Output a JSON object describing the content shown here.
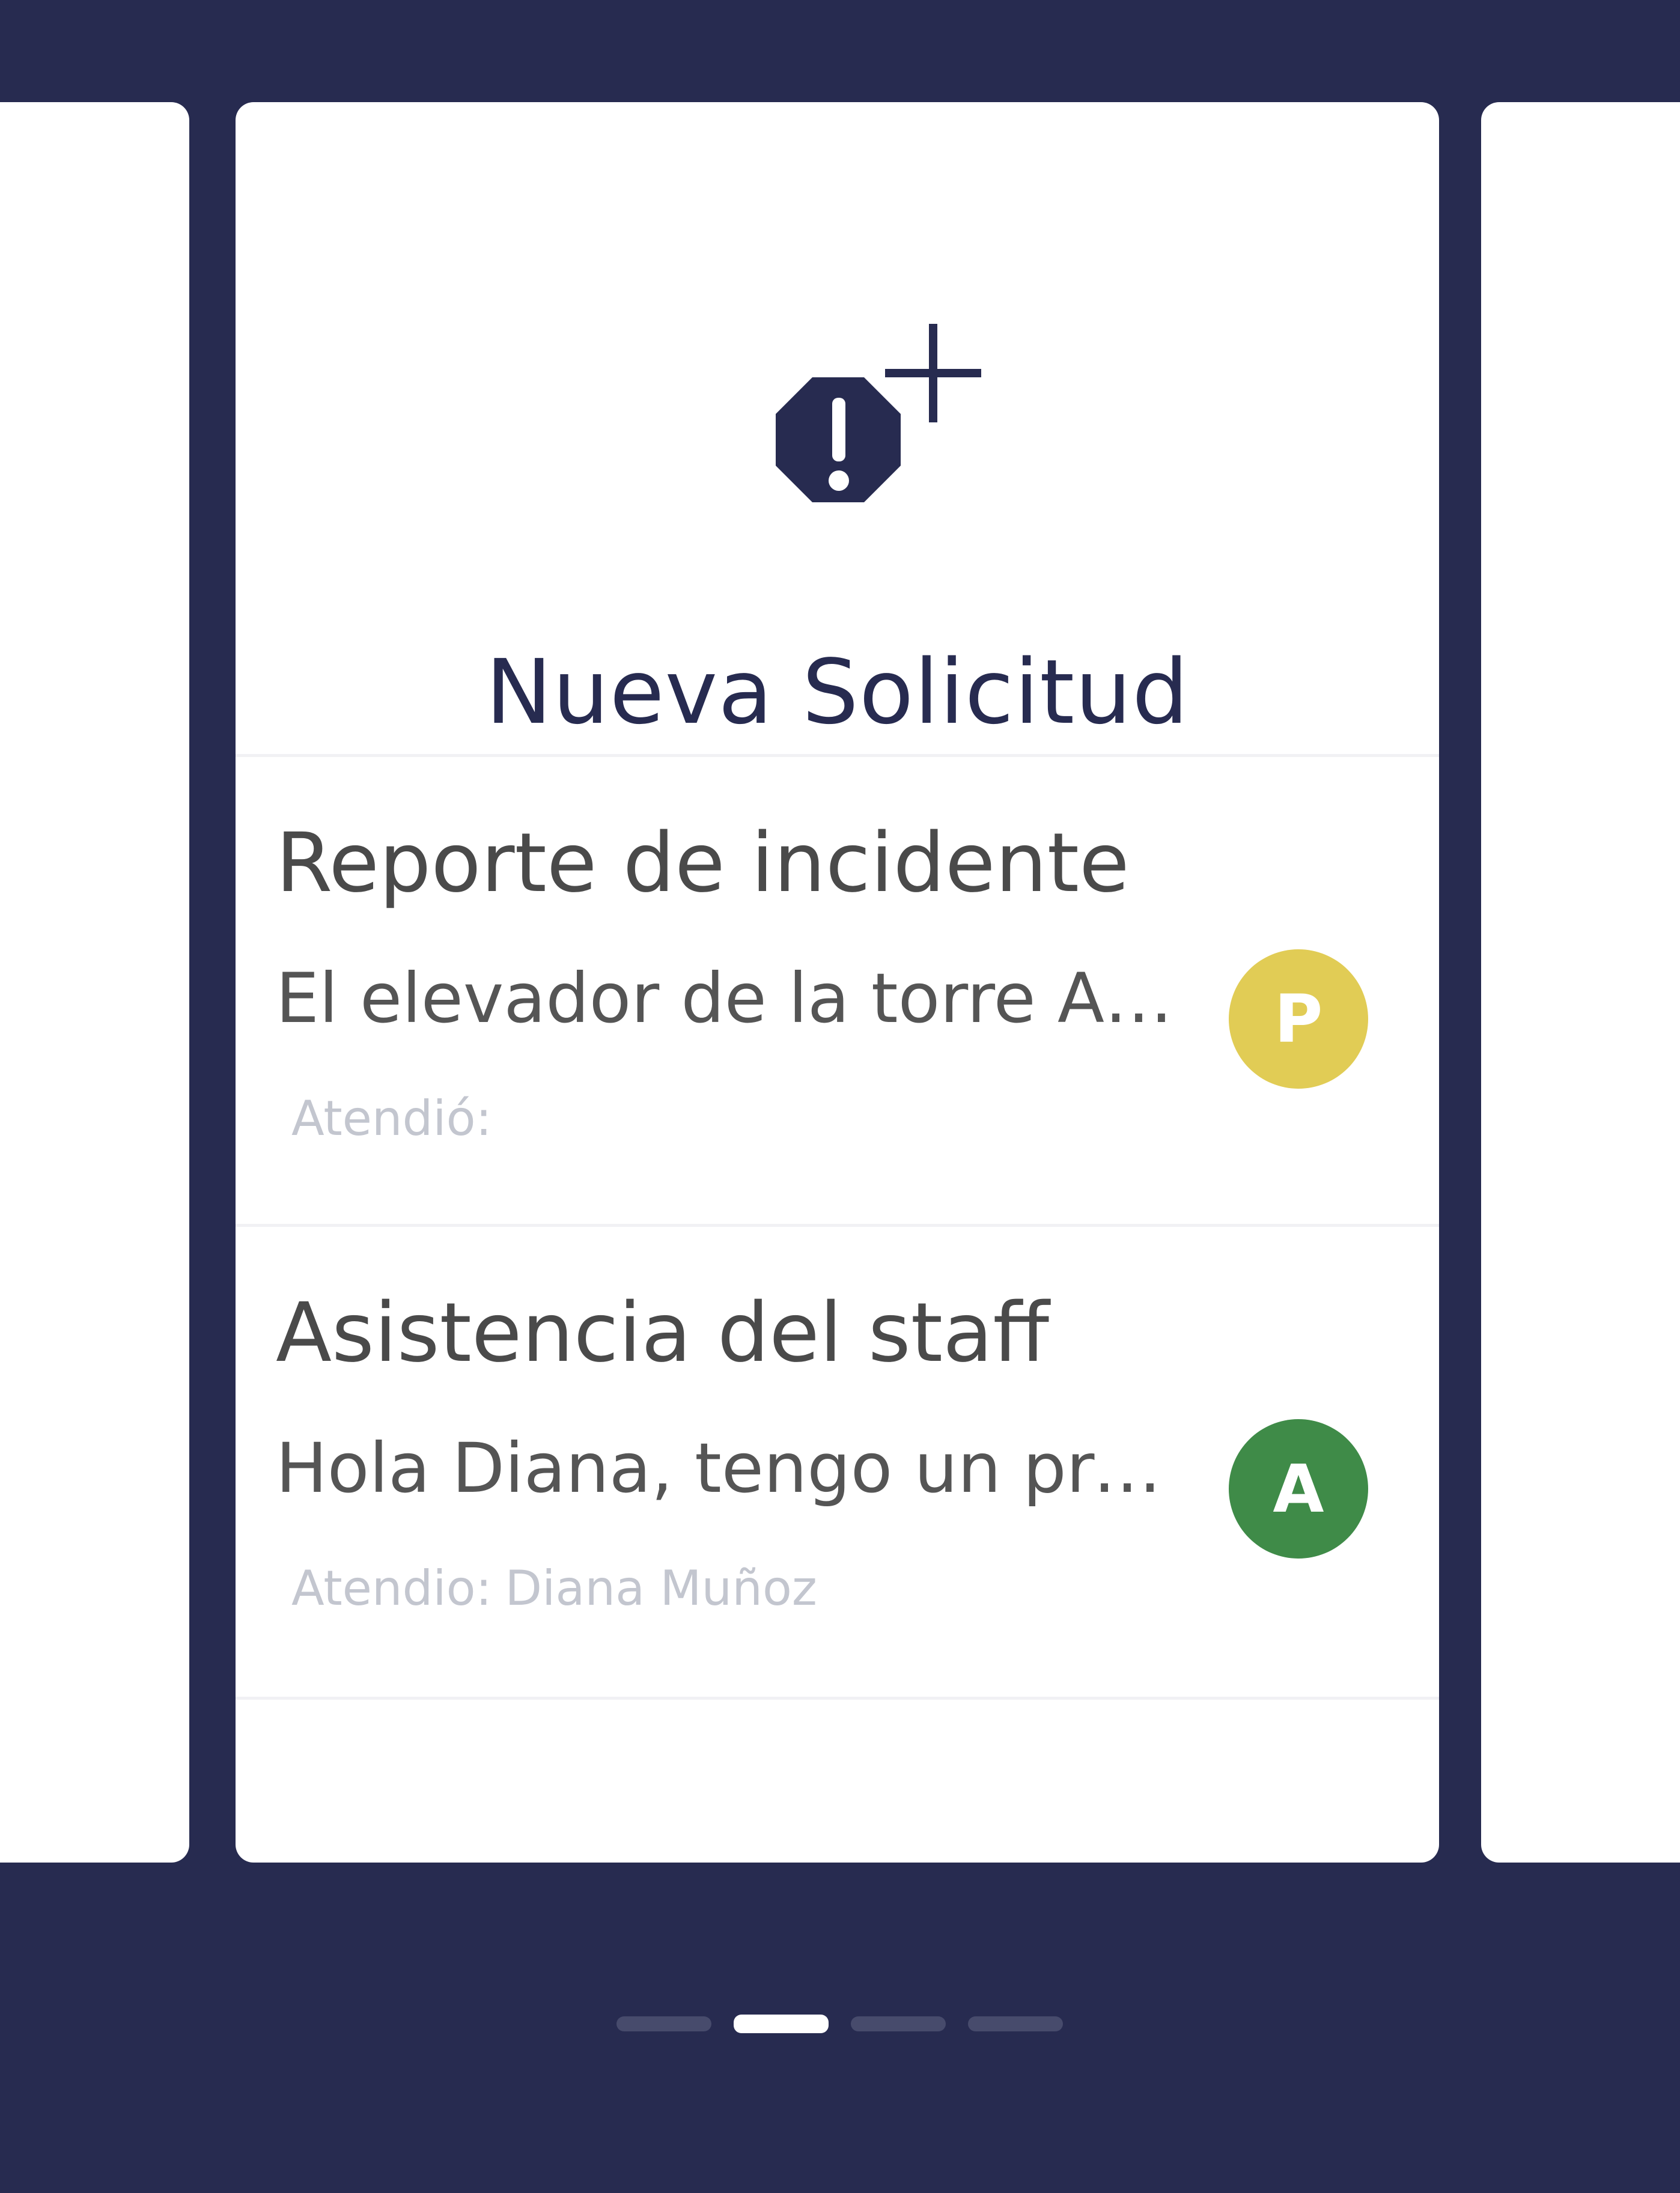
{
  "new_request": {
    "icon": "alert-octagon-plus-icon",
    "title": "Nueva Solicitud"
  },
  "requests": [
    {
      "title": "Reporte de incidente",
      "preview": "El elevador de la torre A n...",
      "attended_label": "Atendió:",
      "attended_by": "",
      "avatar_letter": "P",
      "avatar_color": "#e1cc55"
    },
    {
      "title": "Asistencia del staff",
      "preview": "Hola Diana, tengo un prob...",
      "attended_label": "Atendio:",
      "attended_by": "Diana Muñoz",
      "avatar_letter": "A",
      "avatar_color": "#3f8b48"
    }
  ],
  "pager": {
    "page_count": 4,
    "active_page": 2
  },
  "colors": {
    "background": "#272b50",
    "accent": "#272b50",
    "card": "#ffffff"
  }
}
